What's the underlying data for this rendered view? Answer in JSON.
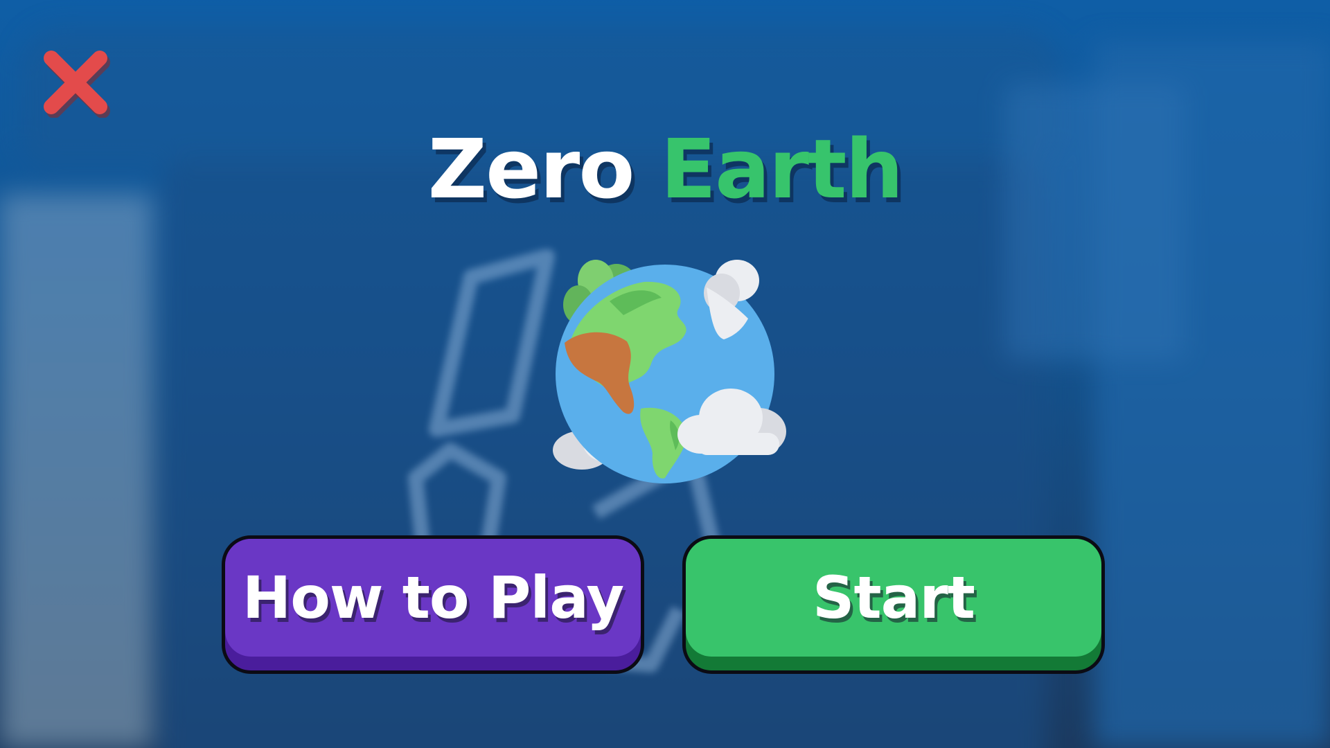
{
  "title": {
    "word1": "Zero",
    "word2": "Earth"
  },
  "buttons": {
    "how_to_play": "How to Play",
    "start": "Start"
  },
  "icons": {
    "close": "close-icon",
    "globe": "earth-globe-icon",
    "background": "recycling-bin-blurred"
  },
  "colors": {
    "title_primary": "#ffffff",
    "title_accent": "#37c46c",
    "how_to_play_button": "#6a37c5",
    "start_button": "#38c46b",
    "close_icon": "#e34b4b",
    "background": "#13538f"
  }
}
